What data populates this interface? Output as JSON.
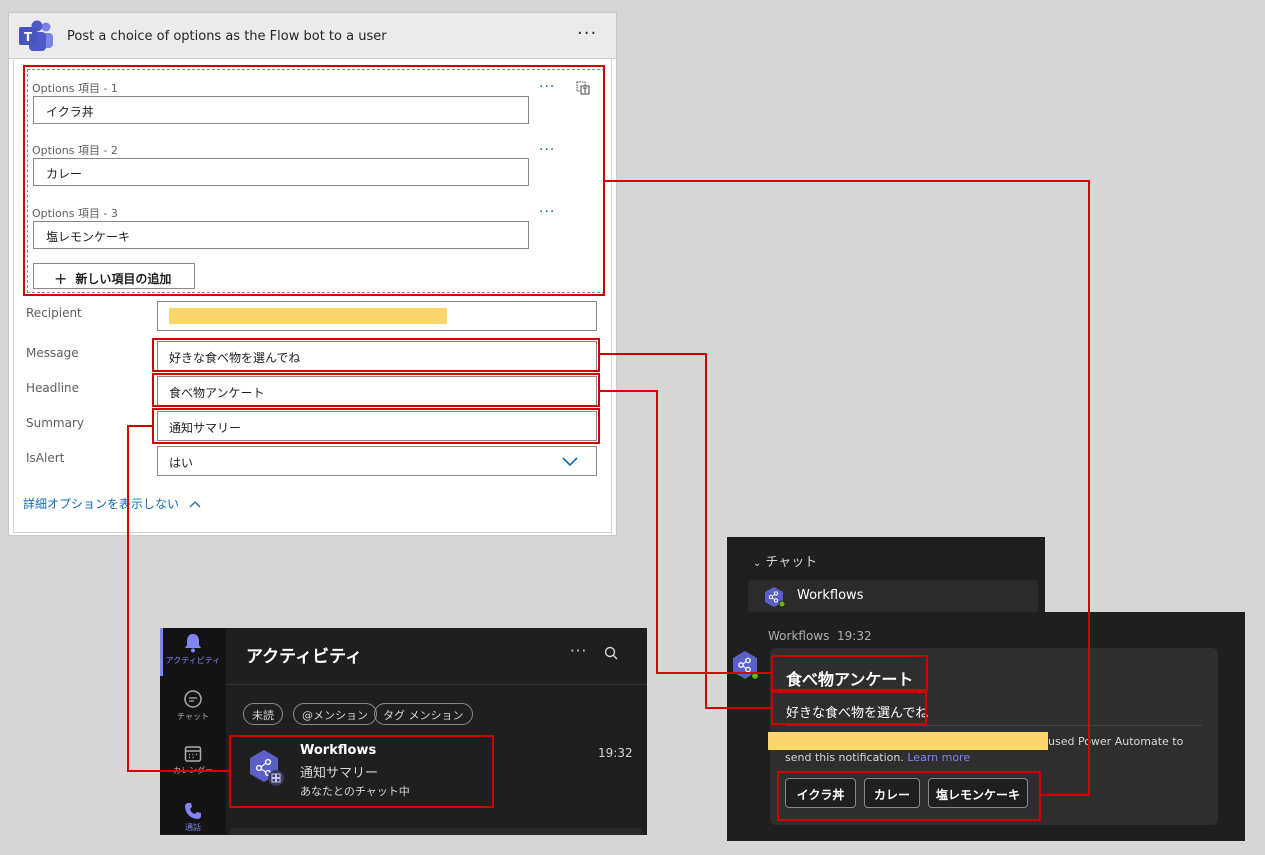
{
  "power_automate": {
    "title": "Post a choice of options as the Flow bot to a user",
    "more_label": "···",
    "options": [
      {
        "label": "Options 項目 - 1",
        "value": "イクラ丼"
      },
      {
        "label": "Options 項目 - 2",
        "value": "カレー"
      },
      {
        "label": "Options 項目 - 3",
        "value": "塩レモンケーキ"
      }
    ],
    "option_more": "···",
    "add_item_label": "新しい項目の追加",
    "fields": {
      "recipient_label": "Recipient",
      "message_label": "Message",
      "message_value": "好きな食べ物を選んでね",
      "headline_label": "Headline",
      "headline_value": "食べ物アンケート",
      "summary_label": "Summary",
      "summary_value": "通知サマリー",
      "isalert_label": "IsAlert",
      "isalert_value": "はい"
    },
    "advanced_toggle": "詳細オプションを表示しない"
  },
  "activity_panel": {
    "rail": [
      {
        "label": "アクティビティ",
        "icon": "bell-icon"
      },
      {
        "label": "チャット",
        "icon": "chat-icon"
      },
      {
        "label": "カレンダー",
        "icon": "calendar-icon"
      },
      {
        "label": "通話",
        "icon": "phone-icon"
      }
    ],
    "title": "アクティビティ",
    "more_label": "···",
    "filters": [
      "未読",
      "@メンション",
      "タグ メンション"
    ],
    "item": {
      "name": "Workflows",
      "summary": "通知サマリー",
      "subtitle": "あなたとのチャット中",
      "time": "19:32"
    }
  },
  "chat_list": {
    "section_label": "チャット",
    "item_name": "Workflows"
  },
  "message": {
    "sender": "Workflows",
    "time": "19:32",
    "headline": "食べ物アンケート",
    "text": "好きな食べ物を選んでね",
    "notice_part1": "used Power Automate to",
    "notice_part2": "send this notification.",
    "learn_more": "Learn more",
    "choices": [
      "イクラ丼",
      "カレー",
      "塩レモンケーキ"
    ]
  },
  "colors": {
    "annotation_red": "#d40000",
    "teams_purple": "#5b5fc7",
    "link_blue": "#0f6cbd",
    "redaction_yellow": "#fbd66b"
  }
}
